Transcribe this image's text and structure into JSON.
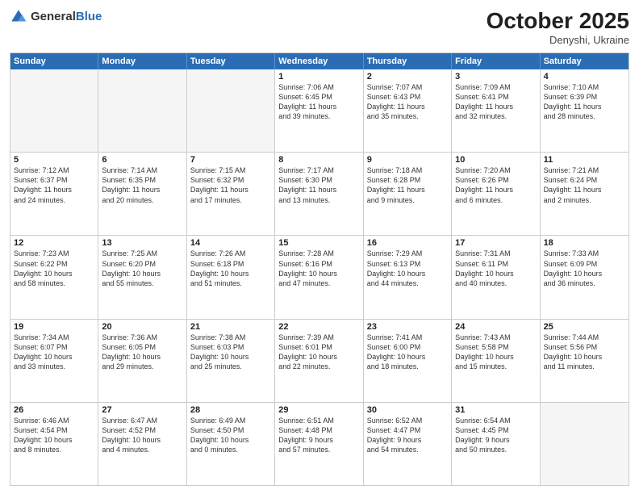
{
  "header": {
    "logo_general": "General",
    "logo_blue": "Blue",
    "month": "October 2025",
    "location": "Denyshi, Ukraine"
  },
  "weekdays": [
    "Sunday",
    "Monday",
    "Tuesday",
    "Wednesday",
    "Thursday",
    "Friday",
    "Saturday"
  ],
  "rows": [
    [
      {
        "day": "",
        "text": "",
        "empty": true
      },
      {
        "day": "",
        "text": "",
        "empty": true
      },
      {
        "day": "",
        "text": "",
        "empty": true
      },
      {
        "day": "1",
        "text": "Sunrise: 7:06 AM\nSunset: 6:45 PM\nDaylight: 11 hours\nand 39 minutes."
      },
      {
        "day": "2",
        "text": "Sunrise: 7:07 AM\nSunset: 6:43 PM\nDaylight: 11 hours\nand 35 minutes."
      },
      {
        "day": "3",
        "text": "Sunrise: 7:09 AM\nSunset: 6:41 PM\nDaylight: 11 hours\nand 32 minutes."
      },
      {
        "day": "4",
        "text": "Sunrise: 7:10 AM\nSunset: 6:39 PM\nDaylight: 11 hours\nand 28 minutes."
      }
    ],
    [
      {
        "day": "5",
        "text": "Sunrise: 7:12 AM\nSunset: 6:37 PM\nDaylight: 11 hours\nand 24 minutes."
      },
      {
        "day": "6",
        "text": "Sunrise: 7:14 AM\nSunset: 6:35 PM\nDaylight: 11 hours\nand 20 minutes."
      },
      {
        "day": "7",
        "text": "Sunrise: 7:15 AM\nSunset: 6:32 PM\nDaylight: 11 hours\nand 17 minutes."
      },
      {
        "day": "8",
        "text": "Sunrise: 7:17 AM\nSunset: 6:30 PM\nDaylight: 11 hours\nand 13 minutes."
      },
      {
        "day": "9",
        "text": "Sunrise: 7:18 AM\nSunset: 6:28 PM\nDaylight: 11 hours\nand 9 minutes."
      },
      {
        "day": "10",
        "text": "Sunrise: 7:20 AM\nSunset: 6:26 PM\nDaylight: 11 hours\nand 6 minutes."
      },
      {
        "day": "11",
        "text": "Sunrise: 7:21 AM\nSunset: 6:24 PM\nDaylight: 11 hours\nand 2 minutes."
      }
    ],
    [
      {
        "day": "12",
        "text": "Sunrise: 7:23 AM\nSunset: 6:22 PM\nDaylight: 10 hours\nand 58 minutes."
      },
      {
        "day": "13",
        "text": "Sunrise: 7:25 AM\nSunset: 6:20 PM\nDaylight: 10 hours\nand 55 minutes."
      },
      {
        "day": "14",
        "text": "Sunrise: 7:26 AM\nSunset: 6:18 PM\nDaylight: 10 hours\nand 51 minutes."
      },
      {
        "day": "15",
        "text": "Sunrise: 7:28 AM\nSunset: 6:16 PM\nDaylight: 10 hours\nand 47 minutes."
      },
      {
        "day": "16",
        "text": "Sunrise: 7:29 AM\nSunset: 6:13 PM\nDaylight: 10 hours\nand 44 minutes."
      },
      {
        "day": "17",
        "text": "Sunrise: 7:31 AM\nSunset: 6:11 PM\nDaylight: 10 hours\nand 40 minutes."
      },
      {
        "day": "18",
        "text": "Sunrise: 7:33 AM\nSunset: 6:09 PM\nDaylight: 10 hours\nand 36 minutes."
      }
    ],
    [
      {
        "day": "19",
        "text": "Sunrise: 7:34 AM\nSunset: 6:07 PM\nDaylight: 10 hours\nand 33 minutes."
      },
      {
        "day": "20",
        "text": "Sunrise: 7:36 AM\nSunset: 6:05 PM\nDaylight: 10 hours\nand 29 minutes."
      },
      {
        "day": "21",
        "text": "Sunrise: 7:38 AM\nSunset: 6:03 PM\nDaylight: 10 hours\nand 25 minutes."
      },
      {
        "day": "22",
        "text": "Sunrise: 7:39 AM\nSunset: 6:01 PM\nDaylight: 10 hours\nand 22 minutes."
      },
      {
        "day": "23",
        "text": "Sunrise: 7:41 AM\nSunset: 6:00 PM\nDaylight: 10 hours\nand 18 minutes."
      },
      {
        "day": "24",
        "text": "Sunrise: 7:43 AM\nSunset: 5:58 PM\nDaylight: 10 hours\nand 15 minutes."
      },
      {
        "day": "25",
        "text": "Sunrise: 7:44 AM\nSunset: 5:56 PM\nDaylight: 10 hours\nand 11 minutes."
      }
    ],
    [
      {
        "day": "26",
        "text": "Sunrise: 6:46 AM\nSunset: 4:54 PM\nDaylight: 10 hours\nand 8 minutes."
      },
      {
        "day": "27",
        "text": "Sunrise: 6:47 AM\nSunset: 4:52 PM\nDaylight: 10 hours\nand 4 minutes."
      },
      {
        "day": "28",
        "text": "Sunrise: 6:49 AM\nSunset: 4:50 PM\nDaylight: 10 hours\nand 0 minutes."
      },
      {
        "day": "29",
        "text": "Sunrise: 6:51 AM\nSunset: 4:48 PM\nDaylight: 9 hours\nand 57 minutes."
      },
      {
        "day": "30",
        "text": "Sunrise: 6:52 AM\nSunset: 4:47 PM\nDaylight: 9 hours\nand 54 minutes."
      },
      {
        "day": "31",
        "text": "Sunrise: 6:54 AM\nSunset: 4:45 PM\nDaylight: 9 hours\nand 50 minutes."
      },
      {
        "day": "",
        "text": "",
        "empty": true
      }
    ]
  ]
}
